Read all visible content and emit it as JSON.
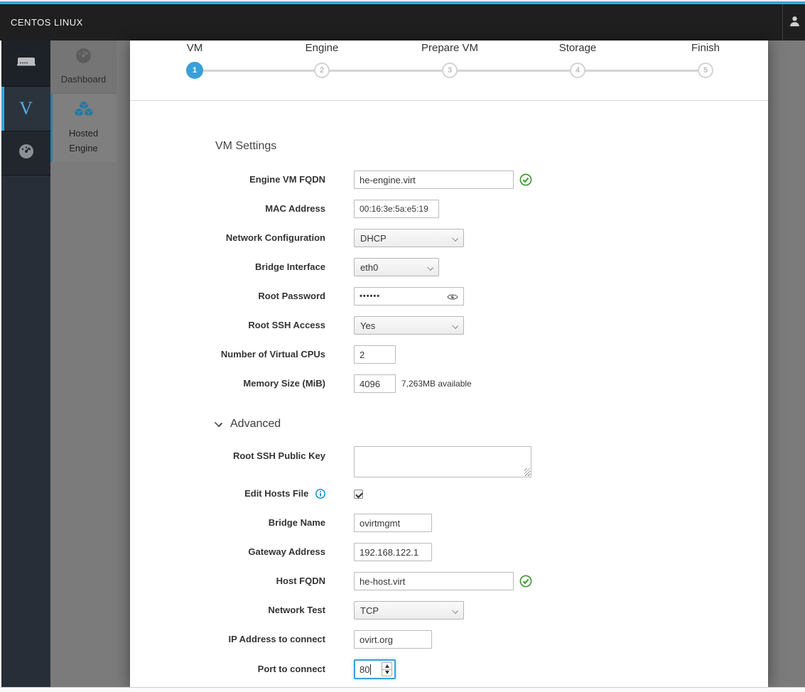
{
  "header": {
    "brand": "CENTOS LINUX"
  },
  "nav": {
    "primary": [
      {
        "name": "host-machine",
        "icon": "server-icon"
      },
      {
        "name": "ovirt-virtualization",
        "label": "V",
        "active": true
      },
      {
        "name": "cluster-dashboard",
        "icon": "dashboard-icon"
      }
    ],
    "secondary": [
      {
        "label": "Dashboard",
        "icon": "dashboard-icon",
        "active": false
      },
      {
        "label_line1": "Hosted",
        "label_line2": "Engine",
        "icon": "cubes-icon",
        "active": true
      }
    ]
  },
  "wizard": {
    "steps": [
      {
        "label": "VM",
        "number": "1",
        "active": true
      },
      {
        "label": "Engine",
        "number": "2",
        "active": false
      },
      {
        "label": "Prepare VM",
        "number": "3",
        "active": false
      },
      {
        "label": "Storage",
        "number": "4",
        "active": false
      },
      {
        "label": "Finish",
        "number": "5",
        "active": false
      }
    ]
  },
  "form": {
    "section_title": "VM Settings",
    "fields": {
      "engine_fqdn": {
        "label": "Engine VM FQDN",
        "value": "he-engine.virt",
        "valid": true
      },
      "mac": {
        "label": "MAC Address",
        "value": "00:16:3e:5a:e5:19"
      },
      "net_config": {
        "label": "Network Configuration",
        "value": "DHCP"
      },
      "bridge_if": {
        "label": "Bridge Interface",
        "value": "eth0"
      },
      "root_password": {
        "label": "Root Password",
        "value": "••••••"
      },
      "root_ssh": {
        "label": "Root SSH Access",
        "value": "Yes"
      },
      "cpus": {
        "label": "Number of Virtual CPUs",
        "value": "2"
      },
      "memory": {
        "label": "Memory Size (MiB)",
        "value": "4096",
        "hint": "7,263MB available"
      }
    },
    "advanced": {
      "title": "Advanced",
      "fields": {
        "ssh_key": {
          "label": "Root SSH Public Key",
          "value": ""
        },
        "edit_hosts": {
          "label": "Edit Hosts File",
          "checked": true
        },
        "bridge_name": {
          "label": "Bridge Name",
          "value": "ovirtmgmt"
        },
        "gateway": {
          "label": "Gateway Address",
          "value": "192.168.122.1"
        },
        "host_fqdn": {
          "label": "Host FQDN",
          "value": "he-host.virt",
          "valid": true
        },
        "net_test": {
          "label": "Network Test",
          "value": "TCP"
        },
        "ip_connect": {
          "label": "IP Address to connect",
          "value": "ovirt.org"
        },
        "port_connect": {
          "label": "Port to connect",
          "value": "80"
        }
      }
    }
  },
  "colors": {
    "accent": "#39a5dc",
    "success": "#3f9c35",
    "info": "#0088ce"
  }
}
